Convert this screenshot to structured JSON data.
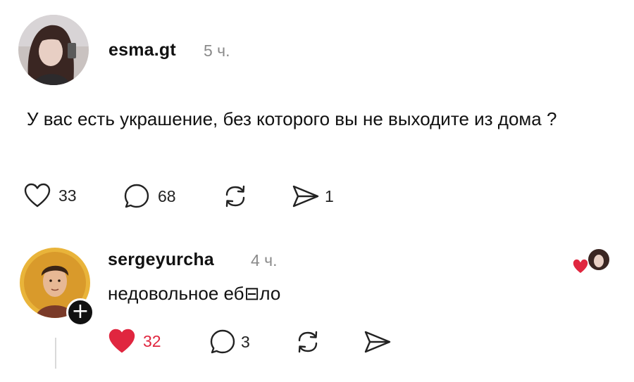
{
  "post": {
    "username": "esma.gt",
    "time": "5 ч.",
    "text": "У вас есть украшение, без которого вы не выходите из дома ?",
    "likes": "33",
    "comments": "68",
    "shares": "1",
    "liked": false
  },
  "reply": {
    "username": "sergeyurcha",
    "time": "4 ч.",
    "text": "недовольное еб⊟ло",
    "likes": "32",
    "comments": "3",
    "liked": true
  },
  "colors": {
    "like_red": "#e0263f",
    "muted_gray": "#8a8a8a",
    "text": "#111111"
  },
  "icons": [
    "heart-icon",
    "comment-icon",
    "repost-icon",
    "send-icon",
    "plus-icon"
  ]
}
